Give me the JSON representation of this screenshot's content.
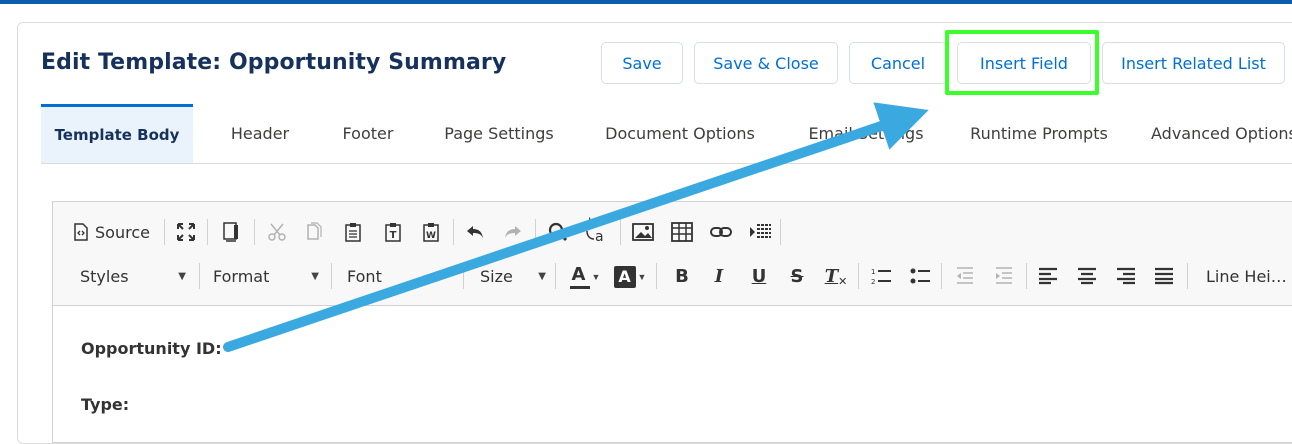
{
  "page": {
    "title": "Edit Template: Opportunity Summary"
  },
  "actions": {
    "save": "Save",
    "save_close": "Save & Close",
    "cancel": "Cancel",
    "insert_field": "Insert Field",
    "insert_related_list": "Insert Related List"
  },
  "tabs": [
    {
      "label": "Template Body"
    },
    {
      "label": "Header"
    },
    {
      "label": "Footer"
    },
    {
      "label": "Page Settings"
    },
    {
      "label": "Document Options"
    },
    {
      "label": "Email Settings"
    },
    {
      "label": "Runtime Prompts"
    },
    {
      "label": "Advanced Options"
    }
  ],
  "toolbar": {
    "source_label": "Source",
    "styles_label": "Styles",
    "format_label": "Format",
    "font_label": "Font",
    "size_label": "Size",
    "line_height_label": "Line Hei…",
    "bold_glyph": "B",
    "italic_glyph": "I",
    "underline_glyph": "U",
    "strike_glyph": "S",
    "clear_glyph": "T",
    "text_color_glyph": "A",
    "bg_color_glyph": "A"
  },
  "body": {
    "line1": "Opportunity ID:",
    "line2": "Type:"
  },
  "colors": {
    "accent": "#0070d2",
    "highlight": "#3bff2b",
    "arrow": "#3aa9e0",
    "title": "#16325c"
  }
}
